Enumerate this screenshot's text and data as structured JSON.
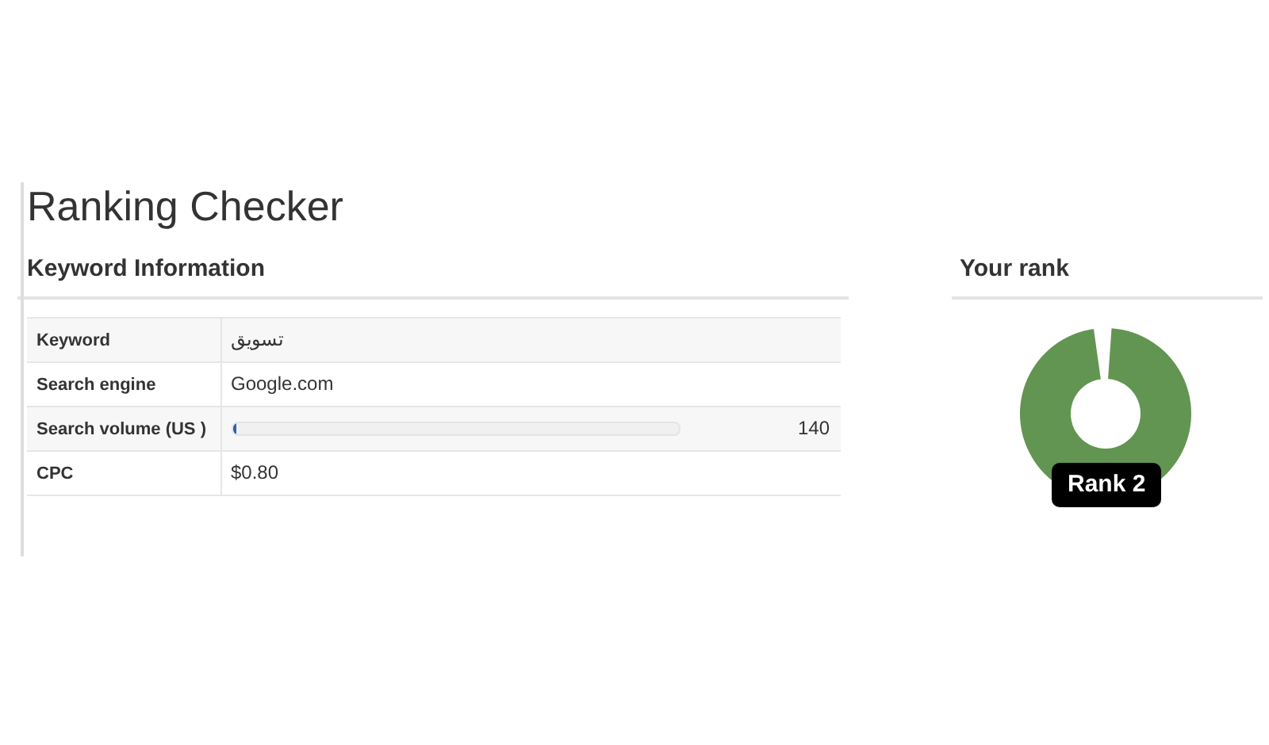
{
  "title": "Ranking Checker",
  "keyword_information": {
    "heading": "Keyword Information",
    "rows": [
      {
        "kind": "text",
        "label": "Keyword",
        "value": "تسويق"
      },
      {
        "kind": "text",
        "label": "Search engine",
        "value": "Google.com"
      },
      {
        "kind": "progress",
        "label": "Search volume (US )",
        "level": 0.01,
        "value": "140"
      },
      {
        "kind": "text",
        "label": "CPC",
        "value": "$0.80"
      }
    ]
  },
  "your_rank": {
    "heading": "Your rank",
    "badge": "Rank 2"
  }
}
